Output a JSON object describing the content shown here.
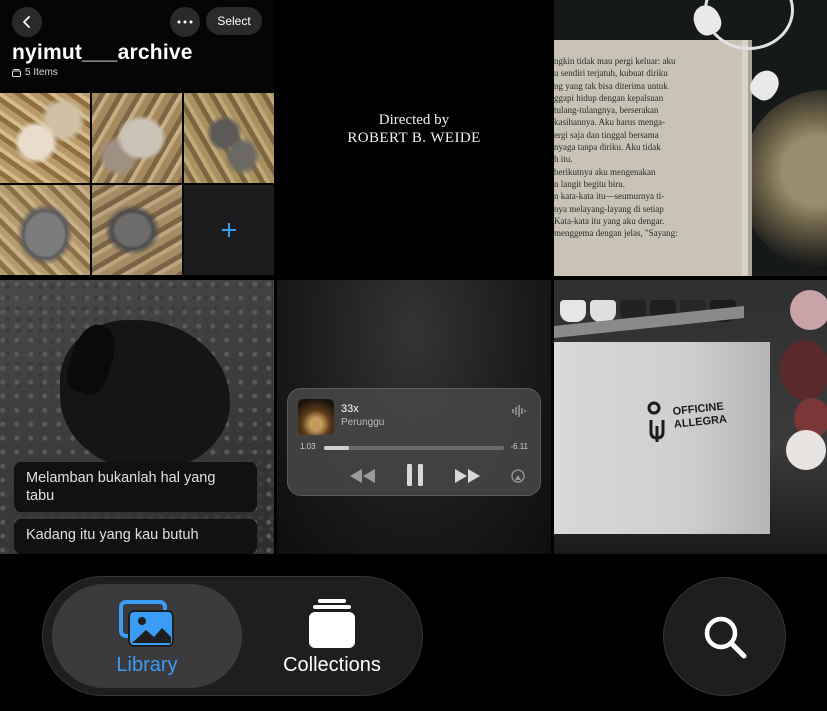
{
  "album": {
    "title": "nyimut___archive",
    "count": "5 Items",
    "select_label": "Select",
    "add_label": "+"
  },
  "credits": {
    "line1": "Directed by",
    "line2": "ROBERT B. WEIDE"
  },
  "book": {
    "text": "ngkin tidak mau pergi keluar: aku\nu sendiri terjatuh, kubuat diriku\nng yang tak bisa diterima untuk\nggapi hidup dengan kepalsuan\ntulang-tulangnya, berserakan\nkasihannya. Aku harus menga-\nergi saja dan tinggal bersama\nnyaga tanpa diriku. Aku tidak\nh itu.\nberikutnya aku mengenakan\nn langit begitu biru.\nn kata-kata itu—seumurnya ti-\nnya melayang-layang di setiap\nKata-kata itu yang aku dengar.\nmenggema dengan jelas, \"Sayang:"
  },
  "street": {
    "caption_1": "Melamban bukanlah hal yang tabu",
    "caption_2": "Kadang itu yang kau butuh"
  },
  "player": {
    "song": "33x",
    "artist": "Perunggu",
    "elapsed": "1.03",
    "remaining": "-6.11",
    "progress": 0.14
  },
  "coffee": {
    "brand_line1": "OFFICINE",
    "brand_line2": "ALLEGRA"
  },
  "tabbar": {
    "library_label": "Library",
    "collections_label": "Collections",
    "active_color": "#3a9cf5"
  },
  "icons": {
    "back": "chevron-left-icon",
    "more": "ellipsis-icon",
    "stack": "stack-icon",
    "waveform": "waveform-icon",
    "rewind": "rewind-icon",
    "pause": "pause-icon",
    "forward": "fast-forward-icon",
    "airplay": "airplay-icon",
    "library": "photos-icon",
    "collections": "collections-icon",
    "search": "search-icon"
  }
}
